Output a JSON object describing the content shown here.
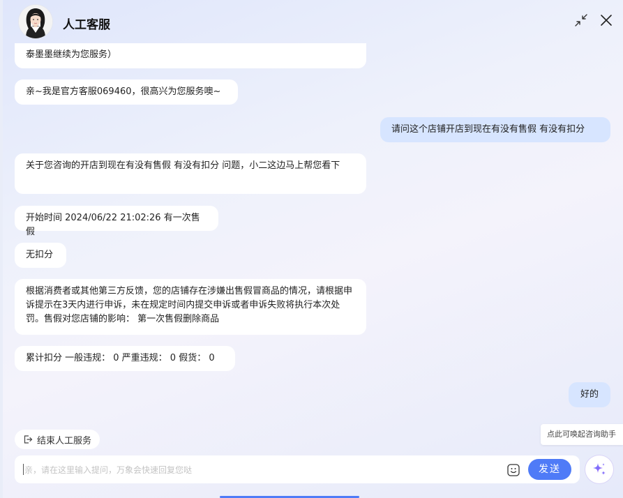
{
  "header": {
    "title": "人工客服"
  },
  "messages": [
    {
      "from": "agent",
      "text": "泰墨墨继续为您服务）"
    },
    {
      "from": "agent",
      "text": "亲~我是官方客服069460，很高兴为您服务噢~"
    },
    {
      "from": "user",
      "text": "请问这个店铺开店到现在有没有售假 有没有扣分"
    },
    {
      "from": "agent",
      "text": "关于您咨询的开店到现在有没有售假 有没有扣分 问题，小二这边马上帮您看下"
    },
    {
      "from": "agent",
      "text": "开始时间 2024/06/22 21:02:26 有一次售假"
    },
    {
      "from": "agent",
      "text": "无扣分"
    },
    {
      "from": "agent",
      "text": "根据消费者或其他第三方反馈，您的店铺存在涉嫌出售假冒商品的情况，请根据申诉提示在3天内进行申诉，未在规定时间内提交申诉或者申诉失败将执行本次处罚。售假对您店铺的影响： 第一次售假删除商品"
    },
    {
      "from": "agent",
      "text": "累计扣分 一般违规： 0 严重违规： 0 假货： 0"
    },
    {
      "from": "user",
      "text": "好的"
    }
  ],
  "end_service": {
    "label": "结束人工服务"
  },
  "input": {
    "placeholder": "亲，请在这里输入提问，万象会快速回复您哒",
    "value": ""
  },
  "send": {
    "label": "发送"
  },
  "assistant": {
    "tooltip": "点此可唤起咨询助手"
  },
  "icons": {
    "minimize": "shrink-arrows-icon",
    "close": "close-icon",
    "emoji": "emoji-icon",
    "assistant": "sparkle-icon",
    "exit": "exit-icon"
  },
  "colors": {
    "accent": "#4f7bf7",
    "user_bubble": "#d7e5ff",
    "agent_bubble": "#ffffff"
  }
}
